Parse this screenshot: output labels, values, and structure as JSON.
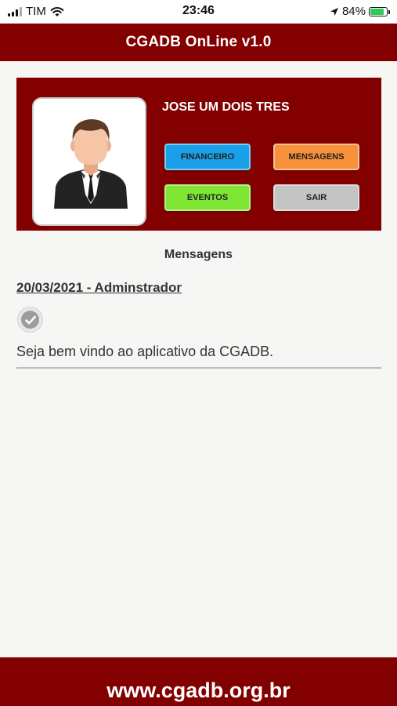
{
  "status_bar": {
    "carrier": "TIM",
    "time": "23:46",
    "battery": "84%",
    "battery_level": 0.84,
    "icons": [
      "signal-icon",
      "wifi-icon",
      "location-icon",
      "battery-icon"
    ]
  },
  "header": {
    "title": "CGADB OnLine v1.0"
  },
  "profile": {
    "name": "JOSE UM DOIS TRES",
    "avatar": "man-in-suit-avatar",
    "buttons": {
      "financeiro": "FINANCEIRO",
      "mensagens": "MENSAGENS",
      "eventos": "EVENTOS",
      "sair": "SAIR"
    }
  },
  "messages": {
    "title": "Mensagens",
    "items": [
      {
        "header": "20/03/2021 - Adminstrador",
        "text": "Seja bem vindo ao aplicativo da CGADB.",
        "icon": "check-icon"
      }
    ]
  },
  "footer": {
    "url": "www.cgadb.org.br"
  },
  "colors": {
    "brand": "#820000",
    "financeiro": "#1aa0e8",
    "mensagens": "#f7913b",
    "eventos": "#7ee632",
    "sair": "#c4c4c4"
  }
}
